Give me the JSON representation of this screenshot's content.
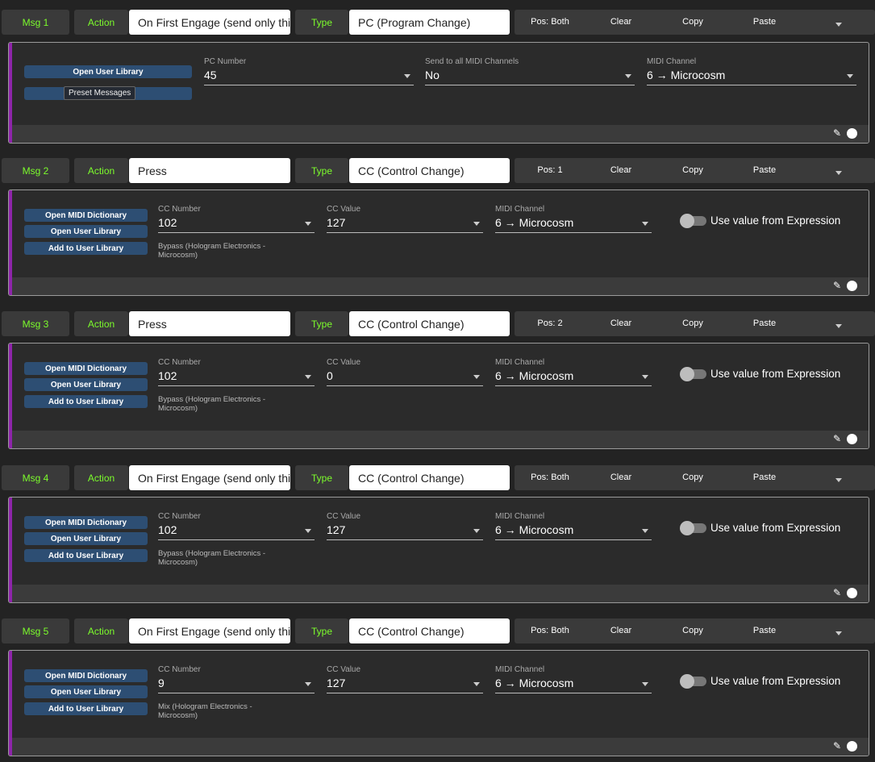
{
  "colors": {
    "accent_green": "#7cfc2c",
    "purple_bar": "#8e24aa",
    "button_blue": "#2d4e73"
  },
  "messages": [
    {
      "label": "Msg 1",
      "action_label": "Action",
      "action_value": "On First Engage (send only thi",
      "type_label": "Type",
      "type_value": "PC (Program Change)",
      "pos": "Pos: Both",
      "clear": "Clear",
      "copy": "Copy",
      "paste": "Paste",
      "kind": "pc",
      "buttons": [
        "Open User Library",
        ""
      ],
      "tooltip": "Preset Messages",
      "fields": [
        {
          "label": "PC Number",
          "value": "45"
        },
        {
          "label": "Send to all MIDI Channels",
          "value": "No"
        },
        {
          "label": "MIDI Channel",
          "value": "6 → Microcosm"
        }
      ]
    },
    {
      "label": "Msg 2",
      "action_label": "Action",
      "action_value": "Press",
      "type_label": "Type",
      "type_value": "CC (Control Change)",
      "pos": "Pos: 1",
      "clear": "Clear",
      "copy": "Copy",
      "paste": "Paste",
      "kind": "cc",
      "buttons": [
        "Open MIDI Dictionary",
        "Open User Library",
        "Add to User Library"
      ],
      "fields": [
        {
          "label": "CC Number",
          "value": "102"
        },
        {
          "label": "CC Value",
          "value": "127"
        },
        {
          "label": "MIDI Channel",
          "value": "6 → Microcosm"
        }
      ],
      "hint": "Bypass (Hologram Electronics - Microcosm)",
      "toggle_label": "Use value from Expression",
      "toggle_on": false
    },
    {
      "label": "Msg 3",
      "action_label": "Action",
      "action_value": "Press",
      "type_label": "Type",
      "type_value": "CC (Control Change)",
      "pos": "Pos: 2",
      "clear": "Clear",
      "copy": "Copy",
      "paste": "Paste",
      "kind": "cc",
      "buttons": [
        "Open MIDI Dictionary",
        "Open User Library",
        "Add to User Library"
      ],
      "fields": [
        {
          "label": "CC Number",
          "value": "102"
        },
        {
          "label": "CC Value",
          "value": "0"
        },
        {
          "label": "MIDI Channel",
          "value": "6 → Microcosm"
        }
      ],
      "hint": "Bypass (Hologram Electronics - Microcosm)",
      "toggle_label": "Use value from Expression",
      "toggle_on": false
    },
    {
      "label": "Msg 4",
      "action_label": "Action",
      "action_value": "On First Engage (send only thi",
      "type_label": "Type",
      "type_value": "CC (Control Change)",
      "pos": "Pos: Both",
      "clear": "Clear",
      "copy": "Copy",
      "paste": "Paste",
      "kind": "cc",
      "buttons": [
        "Open MIDI Dictionary",
        "Open User Library",
        "Add to User Library"
      ],
      "fields": [
        {
          "label": "CC Number",
          "value": "102"
        },
        {
          "label": "CC Value",
          "value": "127"
        },
        {
          "label": "MIDI Channel",
          "value": "6 → Microcosm"
        }
      ],
      "hint": "Bypass (Hologram Electronics - Microcosm)",
      "toggle_label": "Use value from Expression",
      "toggle_on": false
    },
    {
      "label": "Msg 5",
      "action_label": "Action",
      "action_value": "On First Engage (send only thi",
      "type_label": "Type",
      "type_value": "CC (Control Change)",
      "pos": "Pos: Both",
      "clear": "Clear",
      "copy": "Copy",
      "paste": "Paste",
      "kind": "cc",
      "buttons": [
        "Open MIDI Dictionary",
        "Open User Library",
        "Add to User Library"
      ],
      "fields": [
        {
          "label": "CC Number",
          "value": "9"
        },
        {
          "label": "CC Value",
          "value": "127"
        },
        {
          "label": "MIDI Channel",
          "value": "6 → Microcosm"
        }
      ],
      "hint": "Mix (Hologram Electronics - Microcosm)",
      "toggle_label": "Use value from Expression",
      "toggle_on": false
    }
  ]
}
